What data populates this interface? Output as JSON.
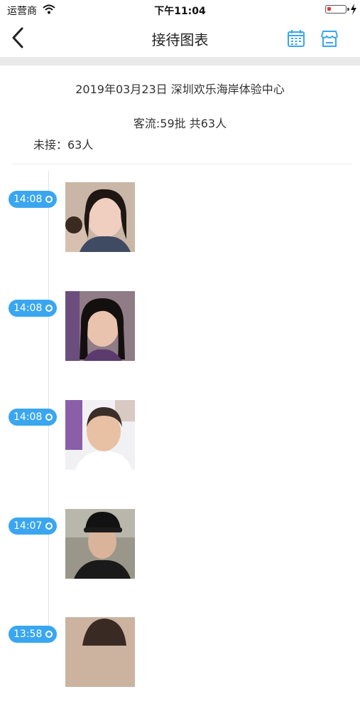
{
  "status_bar": {
    "carrier": "运营商",
    "time": "下午11:04"
  },
  "nav": {
    "title": "接待图表",
    "back_icon": "chevron-left-icon",
    "calendar_icon": "calendar-icon",
    "store_icon": "store-icon"
  },
  "summary": {
    "date_store": "2019年03月23日  深圳欢乐海岸体验中心",
    "flow": "客流:59批  共63人",
    "pending": "未接：63人"
  },
  "colors": {
    "accent": "#3aa6ef",
    "divider": "#e9e9e9"
  },
  "timeline": [
    {
      "time": "14:08"
    },
    {
      "time": "14:08"
    },
    {
      "time": "14:08"
    },
    {
      "time": "14:07"
    },
    {
      "time": "13:58"
    }
  ]
}
